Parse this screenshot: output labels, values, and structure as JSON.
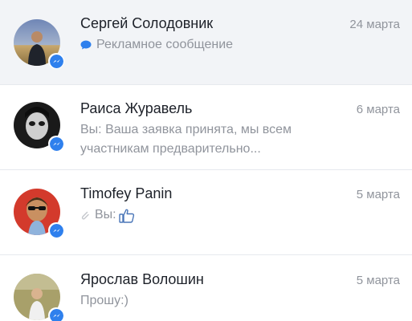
{
  "conversations": [
    {
      "name": "Сергей Солодовник",
      "date": "24 марта",
      "preview": "Рекламное сообщение",
      "preview_icon": "speech-bubble-icon",
      "selected": true
    },
    {
      "name": "Раиса Журавель",
      "date": "6 марта",
      "preview_line1": "Вы: Ваша заявка принята, мы всем",
      "preview_line2": "участникам предварительно..."
    },
    {
      "name": "Timofey Panin",
      "date": "5 марта",
      "preview": "Вы:",
      "preview_icon": "paperclip-icon",
      "preview_sticker": "thumbs-up-icon"
    },
    {
      "name": "Ярослав Волошин",
      "date": "5 марта",
      "preview": "Прошу:)"
    }
  ],
  "colors": {
    "messenger_blue": "#2f80ed",
    "selected_bg": "#f2f4f7",
    "name_text": "#1d2129",
    "secondary_text": "#90949c"
  },
  "icons": {
    "badge": "messenger-badge-icon"
  }
}
